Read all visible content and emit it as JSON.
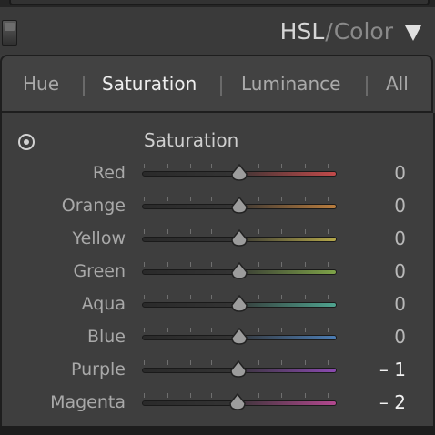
{
  "header": {
    "title_hsl": "HSL",
    "title_separator": "/",
    "title_color": "Color",
    "collapse_icon": "triangle-down-icon",
    "solo_toggle_icon": "panel-switch-icon"
  },
  "tabs": [
    {
      "label": "Hue",
      "active": false
    },
    {
      "label": "Saturation",
      "active": true
    },
    {
      "label": "Luminance",
      "active": false
    },
    {
      "label": "All",
      "active": false
    }
  ],
  "section": {
    "title": "Saturation",
    "adjust_icon": "target-adjustment-icon"
  },
  "slider_range": [
    -100,
    100
  ],
  "sliders": [
    {
      "key": "red",
      "label": "Red",
      "value": 0,
      "display": "0",
      "color": "#c24a4a"
    },
    {
      "key": "orange",
      "label": "Orange",
      "value": 0,
      "display": "0",
      "color": "#b97d3e"
    },
    {
      "key": "yellow",
      "label": "Yellow",
      "value": 0,
      "display": "0",
      "color": "#b4a74a"
    },
    {
      "key": "green",
      "label": "Green",
      "value": 0,
      "display": "0",
      "color": "#7ea348"
    },
    {
      "key": "aqua",
      "label": "Aqua",
      "value": 0,
      "display": "0",
      "color": "#4fa38f"
    },
    {
      "key": "blue",
      "label": "Blue",
      "value": 0,
      "display": "0",
      "color": "#4c7db4"
    },
    {
      "key": "purple",
      "label": "Purple",
      "value": -1,
      "display": "– 1",
      "color": "#8b4ab1"
    },
    {
      "key": "magenta",
      "label": "Magenta",
      "value": -2,
      "display": "– 2",
      "color": "#b2488f"
    }
  ],
  "colors": {
    "panel_bg": "#3e3e3e",
    "text_active": "#eeeeee",
    "text_inactive": "#aaaaaa"
  }
}
